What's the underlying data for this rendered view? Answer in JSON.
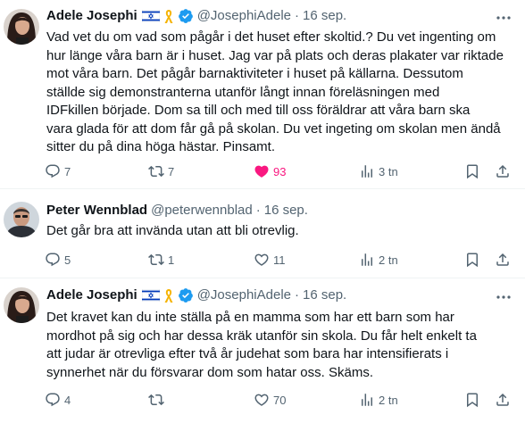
{
  "tweets": [
    {
      "name": "Adele Josephi",
      "handle": "@JosephiAdele",
      "date": "16 sep.",
      "text": "Vad vet du om vad som pågår i det huset efter skoltid.? Du vet ingenting om\nhur länge våra barn är i huset. Jag var på plats och deras plakater var riktade\nmot våra barn. Det pågår barnaktiviteter i huset på källarna. Dessutom\nställde sig demonstranterna utanför långt innan föreläsningen med\nIDFkillen började.  Dom sa till och med till oss föräldrar att våra barn ska\nvara glada för att dom får gå på skolan. Du vet ingeting om skolan men ändå\nsitter du på dina höga hästar. Pinsamt.",
      "replies": "7",
      "reposts": "7",
      "likes": "93",
      "views": "3 tn"
    },
    {
      "name": "Peter Wennblad",
      "handle": "@peterwennblad",
      "date": "16 sep.",
      "text": "Det går bra att invända utan att bli otrevlig.",
      "replies": "5",
      "reposts": "1",
      "likes": "11",
      "views": "2 tn"
    },
    {
      "name": "Adele Josephi",
      "handle": "@JosephiAdele",
      "date": "16 sep.",
      "text": "Det kravet kan du inte ställa på en mamma som har ett barn som har\nmordhot på sig och har dessa kräk utanför sin skola. Du får helt enkelt ta\natt judar är otrevliga efter två år judehat som bara har intensifierats i\nsynnerhet när du försvarar dom som hatar oss. Skäms.",
      "replies": "4",
      "reposts": "",
      "likes": "70",
      "views": "2 tn"
    }
  ],
  "icons": {
    "reply": "reply-icon",
    "repost": "repost-icon",
    "like": "heart-icon",
    "views": "views-icon",
    "bookmark": "bookmark-icon",
    "share": "share-icon",
    "more": "more-icon"
  },
  "colors": {
    "text": "#0f1419",
    "muted": "#536471",
    "like": "#f91880",
    "verified": "#1d9bf0",
    "flag": "#0038b8",
    "ribbon": "#f5b301"
  }
}
